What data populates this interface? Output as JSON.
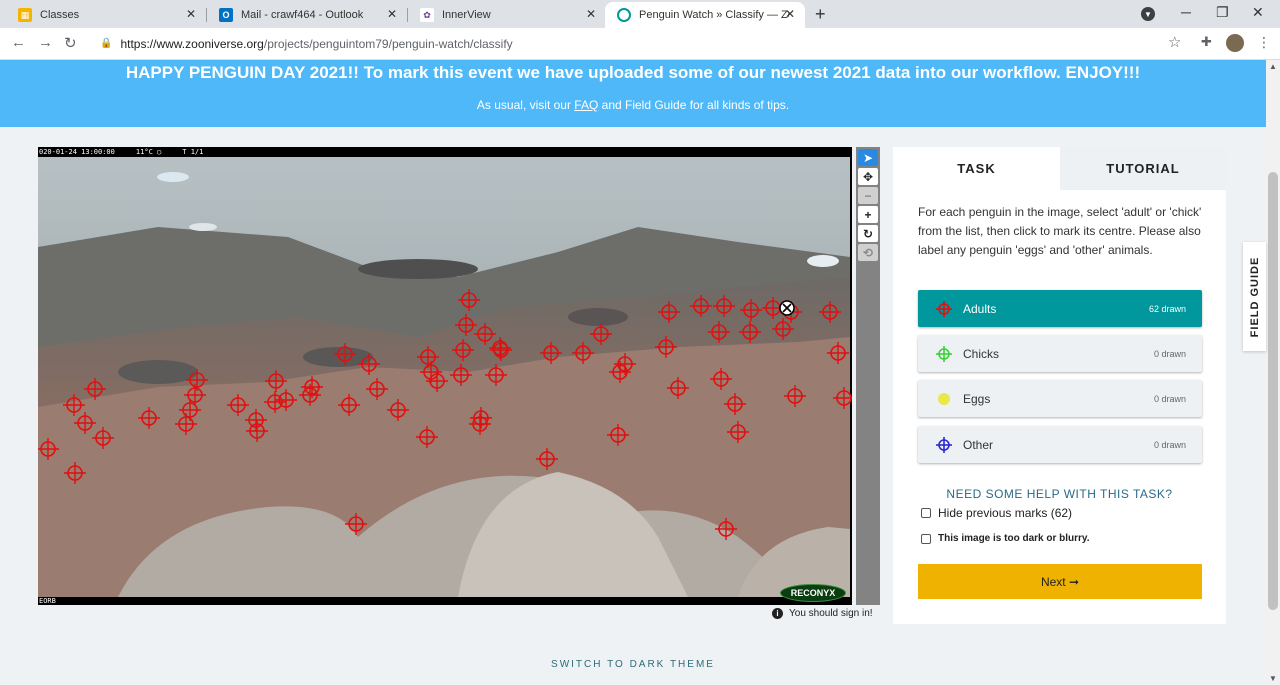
{
  "browser": {
    "tabs": [
      {
        "title": "Classes",
        "icon": "classroom-icon",
        "color": "#f4b400"
      },
      {
        "title": "Mail - crawf464 - Outlook",
        "icon": "outlook-icon",
        "color": "#0072c6"
      },
      {
        "title": "InnerView",
        "icon": "innerview-icon",
        "color": "#6a3d9a"
      },
      {
        "title": "Penguin Watch » Classify — Zooniverse",
        "icon": "zooniverse-icon",
        "color": "#00979d"
      }
    ],
    "url_host": "https://www.zooniverse.org",
    "url_path": "/projects/penguintom79/penguin-watch/classify"
  },
  "banner": {
    "title": "HAPPY PENGUIN DAY 2021!! To mark this event we have uploaded some of our newest 2021 data into our workflow. ENJOY!!!",
    "sub_before": "As usual, visit our ",
    "faq": "FAQ",
    "sub_after": " and Field Guide for all kinds of tips."
  },
  "viewer": {
    "camera_meta": "020-01-24 13:00:00     11°C ◯     T 1/1",
    "camera_foot": "EORB",
    "brand": "RECONYX",
    "tools": [
      "pointer-icon",
      "pan-icon",
      "zoom-out-icon",
      "zoom-in-icon",
      "rotate-icon",
      "reset-icon"
    ],
    "sign_in_note": "You should sign in!",
    "mark_color": "#e01010"
  },
  "task_panel": {
    "tab_task": "TASK",
    "tab_tutorial": "TUTORIAL",
    "instructions": "For each penguin in the image, select 'adult' or 'chick' from the list, then click to mark its centre. Please also label any penguin 'eggs' and 'other' animals.",
    "choices": [
      {
        "label": "Adults",
        "count": "62 drawn",
        "icon": "crosshair-red-icon",
        "color": "#e01010",
        "selected": true
      },
      {
        "label": "Chicks",
        "count": "0 drawn",
        "icon": "crosshair-green-icon",
        "color": "#3cd03c",
        "selected": false
      },
      {
        "label": "Eggs",
        "count": "0 drawn",
        "icon": "dot-yellow-icon",
        "color": "#e8e84a",
        "selected": false
      },
      {
        "label": "Other",
        "count": "0 drawn",
        "icon": "crosshair-blue-icon",
        "color": "#2a2ad0",
        "selected": false
      }
    ],
    "help": "NEED SOME HELP WITH THIS TASK?",
    "hide_marks": "Hide previous marks (62)",
    "too_dark": "This image is too dark or blurry.",
    "next": "Next ➞"
  },
  "field_guide": "FIELD GUIDE",
  "dark_theme": "SWITCH TO DARK THEME"
}
